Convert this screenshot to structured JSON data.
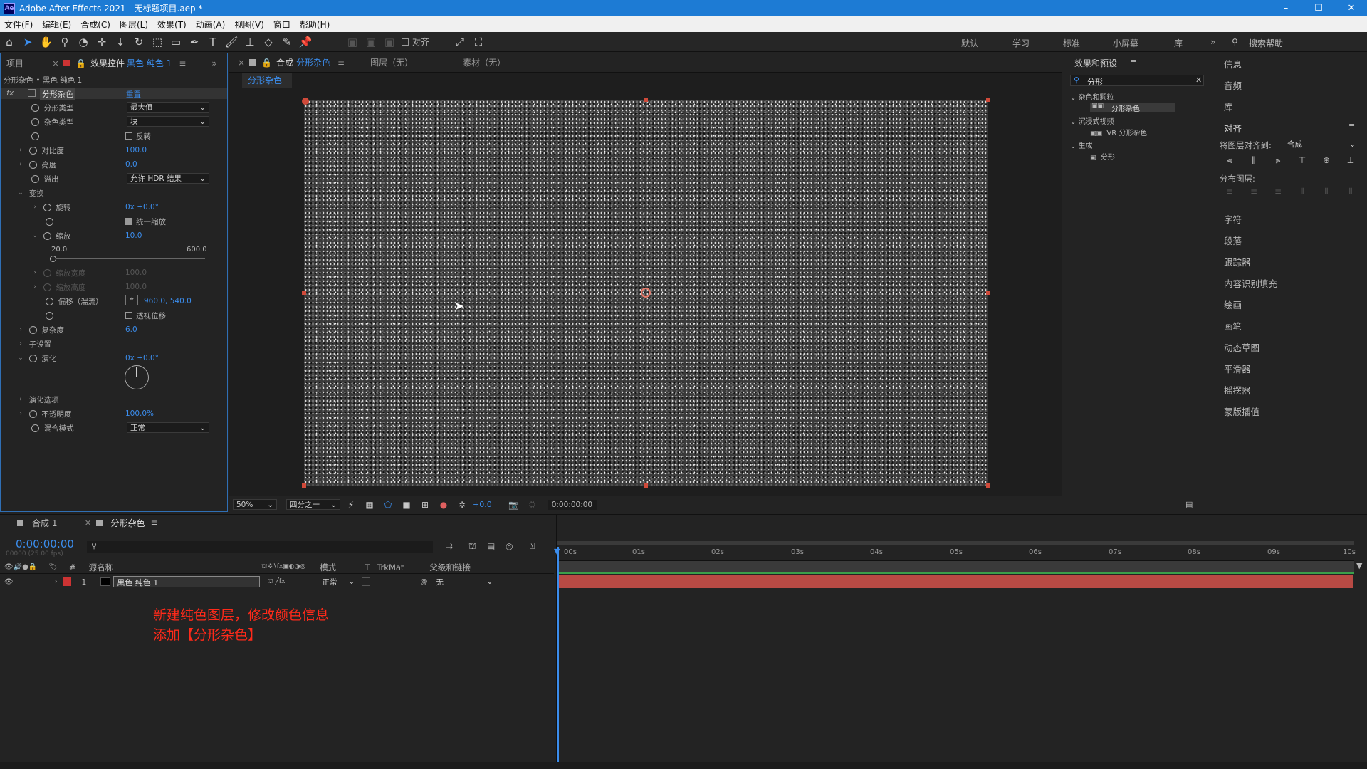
{
  "titlebar": {
    "app_title": "Adobe After Effects 2021 - 无标题项目.aep *",
    "logo": "Ae",
    "minimize": "–",
    "maximize": "☐",
    "close": "✕"
  },
  "menu": [
    "文件(F)",
    "编辑(E)",
    "合成(C)",
    "图层(L)",
    "效果(T)",
    "动画(A)",
    "视图(V)",
    "窗口",
    "帮助(H)"
  ],
  "toolbar": {
    "align_label": "对齐",
    "workspaces": [
      "默认",
      "学习",
      "标准",
      "小屏幕",
      "库"
    ],
    "search_help": "搜索帮助"
  },
  "left_panel": {
    "tab_project": "项目",
    "tab_effects_prefix": "效果控件",
    "tab_effects_layer": "黑色 纯色 1",
    "breadcrumb": "分形杂色 • 黑色 纯色 1",
    "effect_name": "分形杂色",
    "reset": "重置",
    "rows": {
      "fractal_type": "分形类型",
      "fractal_type_val": "最大值",
      "noise_type": "杂色类型",
      "noise_type_val": "块",
      "invert": "反转",
      "contrast": "对比度",
      "contrast_val": "100.0",
      "brightness": "亮度",
      "brightness_val": "0.0",
      "overflow": "溢出",
      "overflow_val": "允许 HDR 结果",
      "transform": "变换",
      "rotation": "旋转",
      "rotation_val": "0x +0.0°",
      "uniform_scale": "统一缩放",
      "scale": "缩放",
      "scale_val": "10.0",
      "slider_min": "20.0",
      "slider_max": "600.0",
      "scale_width": "缩放宽度",
      "scale_width_val": "100.0",
      "scale_height": "缩放高度",
      "scale_height_val": "100.0",
      "offset": "偏移（湍流）",
      "offset_val": "960.0, 540.0",
      "perspective": "透视位移",
      "complexity": "复杂度",
      "complexity_val": "6.0",
      "sub_settings": "子设置",
      "evolution": "演化",
      "evolution_val": "0x +0.0°",
      "evolution_options": "演化选项",
      "opacity": "不透明度",
      "opacity_val": "100.0%",
      "blend": "混合模式",
      "blend_val": "正常"
    }
  },
  "comp_panel": {
    "tab_comp": "合成",
    "tab_comp_name": "分形杂色",
    "tab_layer": "图层（无）",
    "tab_footage": "素材（无）",
    "sub_tab": "分形杂色",
    "zoom": "50%",
    "resolution": "四分之一",
    "exposure": "+0.0",
    "timecode": "0:00:00:00"
  },
  "effects_panel": {
    "title": "效果和预设",
    "search": "分形",
    "groups": [
      {
        "name": "杂色和颗粒",
        "item": "分形杂色"
      },
      {
        "name": "沉浸式视频",
        "item": "VR 分形杂色"
      },
      {
        "name": "生成",
        "item": "分形"
      }
    ]
  },
  "right_panel": {
    "items_top": [
      "信息",
      "音频",
      "库"
    ],
    "align": "对齐",
    "align_to_label": "将图层对齐到:",
    "align_to_val": "合成",
    "distribute": "分布图层:",
    "items": [
      "字符",
      "段落",
      "跟踪器",
      "内容识别填充",
      "绘画",
      "画笔",
      "动态草图",
      "平滑器",
      "摇摆器",
      "蒙版插值"
    ]
  },
  "timeline": {
    "tab1": "合成 1",
    "tab2": "分形杂色",
    "timecode": "0:00:00:00",
    "fps": "00000 (25.00 fps)",
    "col_source": "源名称",
    "col_mode": "模式",
    "col_t": "T",
    "col_trkmat": "TrkMat",
    "col_parent": "父级和链接",
    "layer_num": "1",
    "layer_name": "黑色 纯色 1",
    "layer_mode": "正常",
    "layer_parent": "无",
    "ticks": [
      "00s",
      "01s",
      "02s",
      "03s",
      "04s",
      "05s",
      "06s",
      "07s",
      "08s",
      "09s",
      "10s"
    ]
  },
  "annotation": {
    "line1": "新建纯色图层，修改颜色信息",
    "line2": "添加【分形杂色】"
  },
  "colors": {
    "titlebar": "#1d7bd4",
    "accent": "#3b8ded",
    "layer_bar": "#b84a44",
    "annotation": "#ff2a1a"
  }
}
